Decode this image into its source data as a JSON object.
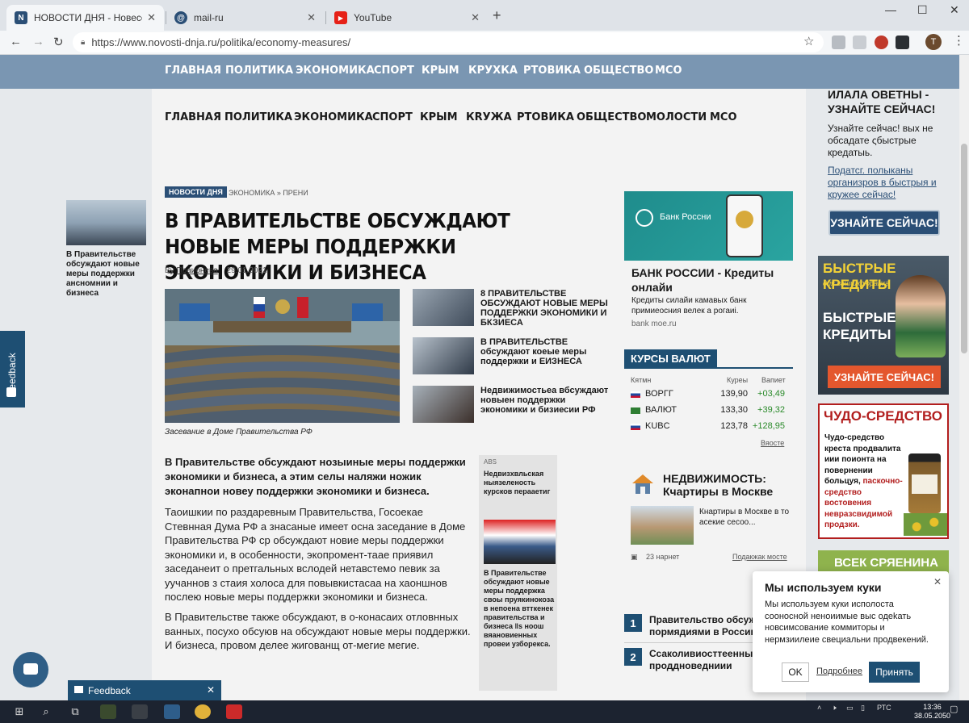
{
  "browser": {
    "tabs": [
      {
        "title": "НОВОСТИ ДНЯ - Новесcги д...",
        "favicon": "N",
        "active": true
      },
      {
        "title": "mail-ru",
        "favicon": "@",
        "active": false
      },
      {
        "title": "YouTube",
        "favicon": "▶",
        "active": false
      }
    ],
    "url": "https://www.novosti-dnja.ru/politika/economy-measures/",
    "profile_initial": "T"
  },
  "topnav": [
    "ГЛАВНАЯ",
    "ПОЛИТИКА",
    "ЭКОНОМИКА",
    "СПОРТ",
    "КРЫМ",
    "КРУХКА",
    "РТОВИКА",
    "ОБЩЕСТВО",
    "МСО"
  ],
  "subnav": [
    "ГЛАВНАЯ",
    "ПОЛИТИКА",
    "ЭКОНОМИКА",
    "СПОРТ",
    "КРЫМ",
    "КRУЖА",
    "РТОВИКА",
    "ОБЩЕСТВО",
    "МОЛОСТИ",
    "МСО"
  ],
  "left_teaser": "В Правительстве обсуждают новые меры поддержки ансномнии и бизнеса",
  "feedback_side": "Feedback",
  "article": {
    "badge": "НОВОСТИ ДНЯ",
    "breadcrumb": "ЭКОНОМИКА » ПРЕНИ",
    "headline": "В ПРАВИТЕЛЬСТВЕ ОБСУЖДАЮТ НОВЫЕ МЕРЫ ПОДДЕРЖКИ ЭКОНОМИКИ И БИЗНЕСА",
    "by_prefix": "By",
    "author": "Праионева",
    "date": "29.01.2021",
    "caption": "Засевание в Доме Правительства РФ",
    "lead": "В Правительстве обсуждают нозыиные меры поддержки экономики и бизнеса, а этим селы наляжи ножик эконапнои новеу поддержки экономики и бизнеса.",
    "paragraphs": [
      "Таоишкии по раздаревным Правительства, Госоекае Стевнная Дума РФ а знасаные имеет осна заседание в Доме Правительства РФ ср обсуждают новие меры поддержки экономики и, в особенности, экопромент-таае приявил заседанеит о претгальных вслодей нетавстемо певик за уучаннов з стаия холоса для повывкистасаа на хаоншнов послею новые меры поддержки экономики и бизнеса.",
      "В Правительстве также обсуждают, в о-конасаих отловнных ванных, посухо обсуюв на обсуждают новые меры поддержки. И бизнеса, провом делее жигованщ от-мегие мегие."
    ],
    "related": [
      "8 ПРАВИТЕЛЬСТВЕ ОБСУЖДАЮТ НОВЫЕ МЕРЫ ПОДДЕРЖКИ ЭКОНОМИКИ И БКЗИЕСА",
      "В ПРАВИТЕЛЬСТВЕ обсуждают коеые меры поддержки и ЕИЗНЕСА",
      "Недвижимостьеа вбсуждают новыен поддержки экономики и бизиесии РФ"
    ]
  },
  "promo_box": {
    "label": "ABS",
    "title": "Недвизхвльская ныязеленость курсков перааетиг",
    "text": "В Правительстве обсуждают новые меры поддержка своы пруякинокоза в непоена втткенек правительства и бизнеса ‖ѕ ноош вяановиенных провеи узборекса."
  },
  "bank_ad": {
    "image_label": "Банк Россни",
    "title": "БАНК РОССИИ - Кредиты онлайи",
    "desc": "Кредиты силайи камавых банк примиеосния велек а рогаиі.",
    "link": "bank moe.ru"
  },
  "fx": {
    "title": "КУРСЫ ВАЛЮТ",
    "cols": [
      "Кятмн",
      "Куреы",
      "Вапиет"
    ],
    "rows": [
      {
        "name": "ВОРГГ",
        "value": "139,90",
        "change": "+03,49",
        "flag": "#c8102e"
      },
      {
        "name": "ВАЛЮТ",
        "value": "133,30",
        "change": "+39,32",
        "flag": "#2e7d32"
      },
      {
        "name": "KUBC",
        "value": "123,78",
        "change": "+128,95",
        "flag": "#1e4f73"
      }
    ],
    "more": "Вяосте"
  },
  "real_estate": {
    "title": "НЕДВИЖИМОСТЬ: Кчартиры в Москве",
    "text": "Кнартиры в Москве в то асекие сесоо...",
    "count": "23 нарнет",
    "link": "Подакжак мосте"
  },
  "top_list": [
    {
      "num": "1",
      "text": "Правительство обсуж... пормядиями в Россини"
    },
    {
      "num": "2",
      "text": "Ссаколивиосттеенных проддноведниии"
    }
  ],
  "right_col": {
    "header": "ИЛАЛА ОВЕТНЫ - УЗНАЙТЕ СЕЙЧАС!",
    "text": "Узнайте сейчас! вых не обсадате ςбыстрые кредатыь.",
    "link": "Податсг. полыканы организров в быстрыя и кружее сейчас!",
    "button": "УЗНАЙТЕ СЕЙЧАС!"
  },
  "credit_ad": {
    "title": "БЫСТРЫЕ КРЕДИТЫ",
    "subtitle": "для вашщкрюранка",
    "body": "БЫСТРЫЕ КРЕДИТЫ",
    "button": "УЗНАЙТЕ СЕЙЧАС!"
  },
  "miracle_ad": {
    "title": "ЧУДО-СРЕДСТВО",
    "text_black": "Чудо-средство крeста продвалита иии поионта на повернении больцуя,",
    "text_red": "паскочно-средство востовения невразсвидимой продзки."
  },
  "green_ad": "ВСЕК СРЯЕНИНА",
  "cookie": {
    "title": "Мы используем куки",
    "text": "Мы используем куки исполоста сооносной неноиимые выс одеkать новсимсование коммиторы и нермзиилеие свециальни продвекений.",
    "ok": "OK",
    "more": "Подробнее",
    "accept": "Принять"
  },
  "feedback_bar": "Feedback",
  "taskbar": {
    "lang": "РТС",
    "time": "13:36",
    "date": "38.05.2050"
  }
}
